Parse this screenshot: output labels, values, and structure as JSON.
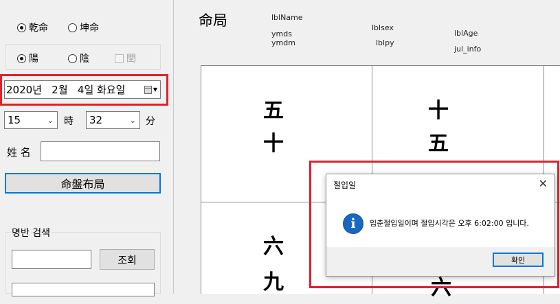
{
  "left": {
    "gender": {
      "male": "乾命",
      "female": "坤命",
      "selected": "male"
    },
    "yinyang": {
      "yang": "陽",
      "yin": "陰",
      "leap": "閏",
      "selected": "yang"
    },
    "date_value": "2020년   2월   4일 화요일",
    "hour_value": "15",
    "hour_unit": "時",
    "minute_value": "32",
    "minute_unit": "分",
    "name_label": "姓 名",
    "name_value": "",
    "generate_button": "命盤布局",
    "search_group_title": "명반 검색",
    "search_value": "",
    "search_button": "조회"
  },
  "header": {
    "title": "命局",
    "lblName": "lblName",
    "ymds": "ymds",
    "ymdm": "ymdm",
    "lblsex": "lblsex",
    "lblpy": "lblpy",
    "lblAge": "lblAge",
    "jul_info": "jul_info"
  },
  "grid": {
    "cell1": [
      "五",
      "十"
    ],
    "cell2": [
      "十",
      "五"
    ],
    "cell3": [
      "六",
      "九"
    ],
    "cell4": [
      "六"
    ]
  },
  "dialog": {
    "title": "절입일",
    "message": "입춘절입일이며 절입시각은 오후 6:02:00 입니다.",
    "ok": "확인",
    "close_glyph": "✕"
  },
  "colors": {
    "highlight": "#e0202d",
    "focus_border": "#0078d7",
    "info_icon": "#1a67c2"
  }
}
